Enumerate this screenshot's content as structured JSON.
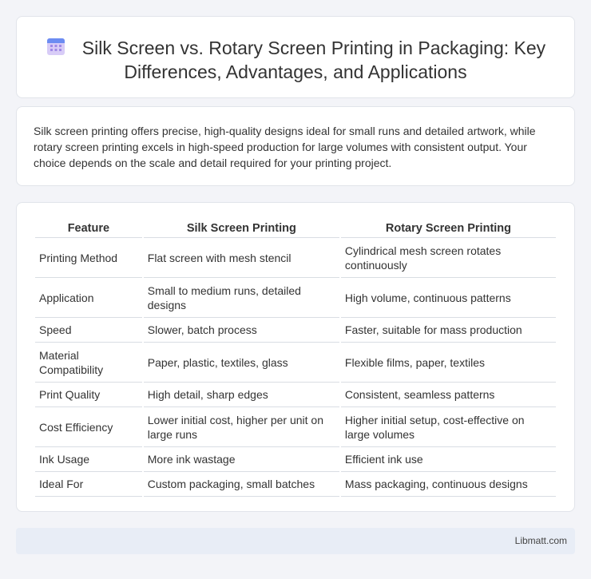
{
  "header": {
    "icon": "calendar-grid-icon",
    "title_line1": "Silk Screen vs. Rotary Screen Printing in Packaging: Key",
    "title_line2": "Differences, Advantages, and Applications"
  },
  "intro": {
    "text": "Silk screen printing offers precise, high-quality designs ideal for small runs and detailed artwork, while rotary screen printing excels in high-speed production for large volumes with consistent output. Your choice depends on the scale and detail required for your printing project."
  },
  "table": {
    "headers": [
      "Feature",
      "Silk Screen Printing",
      "Rotary Screen Printing"
    ],
    "rows": [
      [
        "Printing Method",
        "Flat screen with mesh stencil",
        "Cylindrical mesh screen rotates continuously"
      ],
      [
        "Application",
        "Small to medium runs, detailed designs",
        "High volume, continuous patterns"
      ],
      [
        "Speed",
        "Slower, batch process",
        "Faster, suitable for mass production"
      ],
      [
        "Material Compatibility",
        "Paper, plastic, textiles, glass",
        "Flexible films, paper, textiles"
      ],
      [
        "Print Quality",
        "High detail, sharp edges",
        "Consistent, seamless patterns"
      ],
      [
        "Cost Efficiency",
        "Lower initial cost, higher per unit on large runs",
        "Higher initial setup, cost-effective on large volumes"
      ],
      [
        "Ink Usage",
        "More ink wastage",
        "Efficient ink use"
      ],
      [
        "Ideal For",
        "Custom packaging, small batches",
        "Mass packaging, continuous designs"
      ]
    ]
  },
  "footer": {
    "brand": "Libmatt.com"
  },
  "colors": {
    "icon_top": "#6c8cf2",
    "icon_body": "#c9b8f5",
    "footer_bg": "#e8edf6"
  }
}
